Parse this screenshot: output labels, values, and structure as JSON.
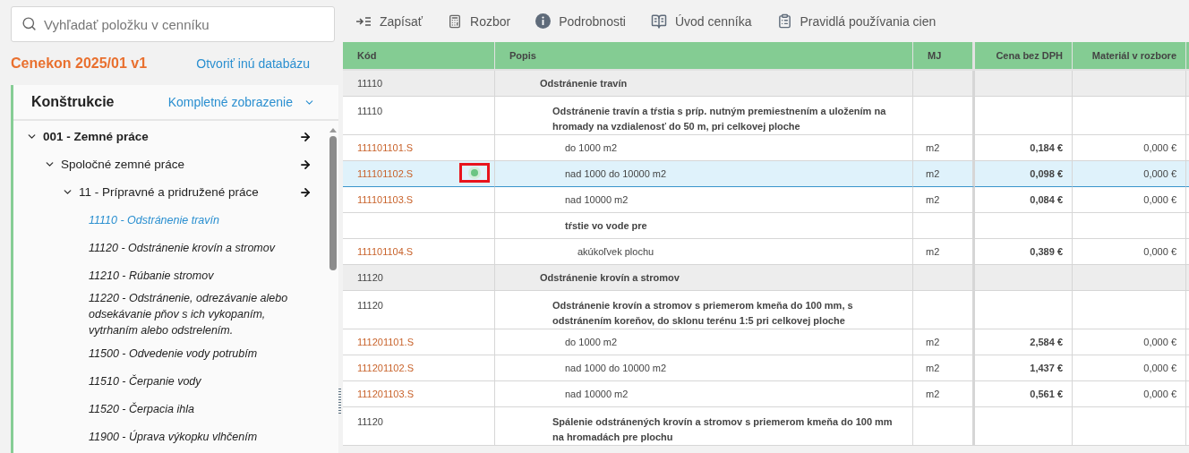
{
  "search": {
    "placeholder": "Vyhľadať položku v cenníku"
  },
  "database": {
    "name": "Cenekon 2025/01 v1",
    "link": "Otvoriť inú databázu"
  },
  "tree_panel": {
    "title": "Konštrukcie",
    "view": "Kompletné zobrazenie"
  },
  "tree": [
    {
      "label": "001 - Zemné práce",
      "expanded": true,
      "children": [
        {
          "label": "Spoločné zemné práce",
          "expanded": true,
          "children": [
            {
              "label": "11 - Prípravné a pridružené práce",
              "expanded": true,
              "children": [
                {
                  "label": "11110 - Odstránenie travín",
                  "selected": true
                },
                {
                  "label": "11120 - Odstránenie krovín a stromov",
                  "selected": false
                },
                {
                  "label": "11210 - Rúbanie stromov",
                  "selected": false
                },
                {
                  "label": "11220 - Odstránenie, odrezávanie alebo odsekávanie pňov s ich vykopaním, vytrhaním alebo odstrelením.",
                  "selected": false
                },
                {
                  "label": "11500 - Odvedenie vody potrubím",
                  "selected": false
                },
                {
                  "label": "11510 - Čerpanie vody",
                  "selected": false
                },
                {
                  "label": "11520 - Čerpacia ihla",
                  "selected": false
                },
                {
                  "label": "11900 - Úprava výkopku vlhčením",
                  "selected": false
                }
              ]
            }
          ]
        }
      ]
    }
  ],
  "toolbar": [
    {
      "kind": "write",
      "label": "Zapísať"
    },
    {
      "kind": "calc",
      "label": "Rozbor"
    },
    {
      "kind": "info",
      "label": "Podrobnosti"
    },
    {
      "kind": "book",
      "label": "Úvod cenníka"
    },
    {
      "kind": "clipboard",
      "label": "Pravidlá používania cien"
    }
  ],
  "table": {
    "columns": [
      "Kód",
      "Popis",
      "MJ",
      "Cena bez DPH",
      "Materiál v rozbore"
    ],
    "rows": [
      {
        "kind": "group",
        "code": "11110",
        "description": "Odstránenie travín",
        "selected": false
      },
      {
        "kind": "heading",
        "code": "11110",
        "description": "Odstránenie travín a tŕstia s príp. nutným premiestnením a uložením na hromady na vzdialenosť do 50 m, pri celkovej ploche",
        "selected": false
      },
      {
        "kind": "item",
        "code": "111101101.S",
        "description": "do 1000 m2",
        "unit": "m2",
        "price": "0,184 €",
        "material": "0,000 €",
        "selected": false
      },
      {
        "kind": "item",
        "code": "111101102.S",
        "description": "nad 1000 do 10000 m2",
        "unit": "m2",
        "price": "0,098 €",
        "material": "0,000 €",
        "selected": true,
        "marker": true
      },
      {
        "kind": "item",
        "code": "111101103.S",
        "description": "nad 10000 m2",
        "unit": "m2",
        "price": "0,084 €",
        "material": "0,000 €",
        "selected": false
      },
      {
        "kind": "subheading",
        "description": "tŕstie vo vode pre",
        "selected": false
      },
      {
        "kind": "subitem",
        "code": "111101104.S",
        "description": "akúkoľvek plochu",
        "unit": "m2",
        "price": "0,389 €",
        "material": "0,000 €",
        "selected": false
      },
      {
        "kind": "group",
        "code": "11120",
        "description": "Odstránenie krovín a stromov",
        "selected": false
      },
      {
        "kind": "heading",
        "code": "11120",
        "description": "Odstránenie krovín a stromov s priemerom kmeňa do 100 mm, s odstránením koreňov, do sklonu terénu 1:5 pri celkovej ploche",
        "selected": false
      },
      {
        "kind": "item",
        "code": "111201101.S",
        "description": "do 1000 m2",
        "unit": "m2",
        "price": "2,584 €",
        "material": "0,000 €",
        "selected": false
      },
      {
        "kind": "item",
        "code": "111201102.S",
        "description": "nad 1000 do 10000 m2",
        "unit": "m2",
        "price": "1,437 €",
        "material": "0,000 €",
        "selected": false
      },
      {
        "kind": "item",
        "code": "111201103.S",
        "description": "nad 10000 m2",
        "unit": "m2",
        "price": "0,561 €",
        "material": "0,000 €",
        "selected": false
      },
      {
        "kind": "heading",
        "code": "11120",
        "description": "Spálenie odstránených krovín a stromov s priemerom kmeňa do 100 mm na hromadách pre plochu",
        "selected": false
      }
    ]
  }
}
